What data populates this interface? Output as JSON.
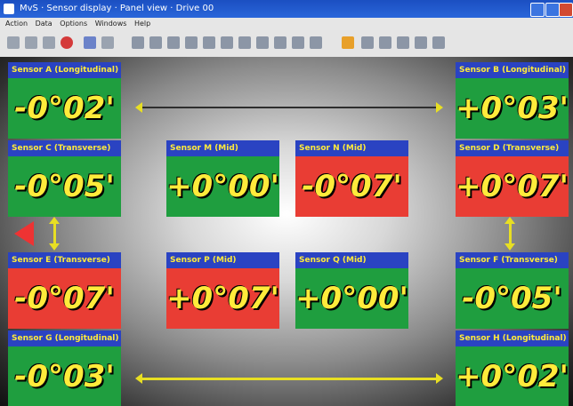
{
  "window": {
    "title": "MvS · Sensor display · Panel view · Drive 00"
  },
  "menubar": {
    "items": [
      "Action",
      "Data",
      "Options",
      "Windows",
      "Help"
    ]
  },
  "toolbar": {
    "icons": [
      "new-icon",
      "back-icon",
      "play-icon",
      "record-icon",
      "tool-icon",
      "settings-icon",
      "sensor1-icon",
      "sensor2-icon",
      "sensor3-icon",
      "sensor4-icon",
      "arrow1-icon",
      "arrow2-icon",
      "arrow3-icon",
      "arrow4-icon",
      "arrow5-icon",
      "tool6-icon",
      "tool7-icon",
      "tool8-icon",
      "tool9-icon",
      "tool10-icon",
      "tool11-icon",
      "tool12-icon",
      "tool13-icon"
    ]
  },
  "sensors": [
    {
      "label": "Sensor A (Longitudinal)",
      "value": "-0°02'",
      "color": "green"
    },
    {
      "label": "Sensor B (Longitudinal)",
      "value": "+0°03'",
      "color": "green"
    },
    {
      "label": "Sensor C (Transverse)",
      "value": "-0°05'",
      "color": "green"
    },
    {
      "label": "Sensor M (Mid)",
      "value": "+0°00'",
      "color": "green"
    },
    {
      "label": "Sensor N (Mid)",
      "value": "-0°07'",
      "color": "red"
    },
    {
      "label": "Sensor D (Transverse)",
      "value": "+0°07'",
      "color": "red"
    },
    {
      "label": "Sensor E (Transverse)",
      "value": "-0°07'",
      "color": "red"
    },
    {
      "label": "Sensor P (Mid)",
      "value": "+0°07'",
      "color": "red"
    },
    {
      "label": "Sensor Q (Mid)",
      "value": "+0°00'",
      "color": "green"
    },
    {
      "label": "Sensor F (Transverse)",
      "value": "-0°05'",
      "color": "green"
    },
    {
      "label": "Sensor G (Longitudinal)",
      "value": "-0°03'",
      "color": "green"
    },
    {
      "label": "Sensor H (Longitudinal)",
      "value": "+0°02'",
      "color": "green"
    }
  ],
  "colors": {
    "panel_green": "#1f9e3f",
    "panel_red": "#e93d34",
    "label_blue": "#2a43c2",
    "value_yellow": "#ffeb3b"
  }
}
